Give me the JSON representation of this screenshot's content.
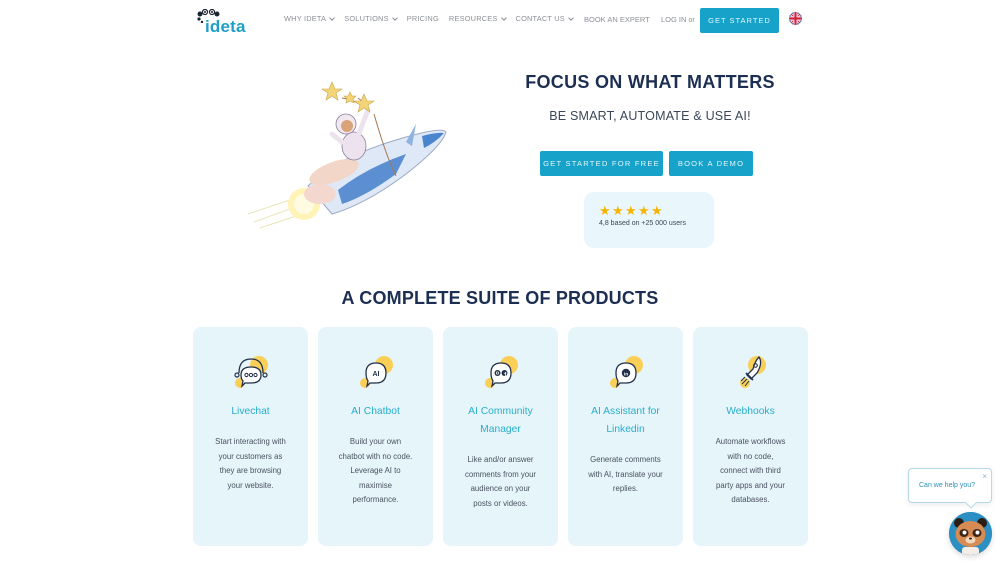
{
  "header": {
    "logo_text": "ideta",
    "nav": [
      {
        "label": "WHY IDETA",
        "has_dropdown": true
      },
      {
        "label": "SOLUTIONS",
        "has_dropdown": true
      },
      {
        "label": "PRICING",
        "has_dropdown": false
      },
      {
        "label": "RESOURCES",
        "has_dropdown": true
      },
      {
        "label": "CONTACT US",
        "has_dropdown": true
      }
    ],
    "book_expert": "BOOK AN EXPERT",
    "login": "LOG IN",
    "login_or": "or",
    "get_started": "GET STARTED",
    "language_icon": "uk-flag-icon"
  },
  "hero": {
    "title": "FOCUS ON WHAT MATTERS",
    "subtitle": "BE SMART, AUTOMATE & USE AI!",
    "cta_primary": "GET STARTED FOR FREE",
    "cta_secondary": "BOOK A DEMO",
    "rating": {
      "stars": 5,
      "text": "4,8 based on +25 000 users"
    }
  },
  "products": {
    "title": "A COMPLETE SUITE OF PRODUCTS",
    "items": [
      {
        "icon": "livechat-icon",
        "title_lines": [
          "Livechat"
        ],
        "desc_lines": [
          "Start interacting with",
          "your customers as",
          "they are browsing",
          "your website."
        ]
      },
      {
        "icon": "ai-chatbot-icon",
        "title_lines": [
          "AI Chatbot"
        ],
        "desc_lines": [
          "Build your own",
          "chatbot with no code.",
          "Leverage AI to",
          "maximise",
          "performance."
        ]
      },
      {
        "icon": "community-manager-icon",
        "title_lines": [
          "AI Community",
          "Manager"
        ],
        "desc_lines": [
          "Like and/or answer",
          "comments from your",
          "audience on your",
          "posts or videos."
        ]
      },
      {
        "icon": "linkedin-assistant-icon",
        "title_lines": [
          "AI Assistant for",
          "Linkedin"
        ],
        "desc_lines": [
          "Generate comments",
          "with AI, translate your",
          "replies."
        ]
      },
      {
        "icon": "webhooks-rocket-icon",
        "title_lines": [
          "Webhooks"
        ],
        "desc_lines": [
          "Automate workflows",
          "with no code,",
          "connect with third",
          "party apps and your",
          "databases."
        ]
      }
    ]
  },
  "chat_widget": {
    "prompt": "Can we help you?",
    "close_symbol": "×"
  },
  "colors": {
    "accent": "#16a2c9",
    "heading": "#1c2f52",
    "card_bg": "#e6f5fa",
    "card_title": "#28aecb",
    "icon_yellow": "#f9cf57",
    "star": "#f5b400"
  }
}
